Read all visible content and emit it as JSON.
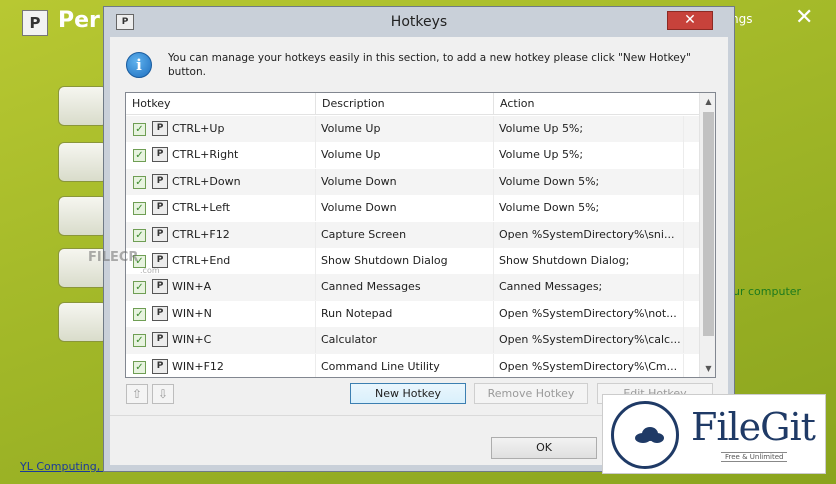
{
  "background": {
    "logo_letter": "P",
    "title_partial": "Per",
    "settings_partial": "ngs",
    "close_glyph": "✕",
    "message_partial": "ur computer",
    "footer_link_partial": "YL Computing, I"
  },
  "dialog": {
    "title": "Hotkeys",
    "title_icon_letter": "P",
    "close_glyph": "✕",
    "info_icon_glyph": "i",
    "info_text": "You can manage your hotkeys easily in this section, to add a new hotkey please click \"New Hotkey\" button.",
    "columns": [
      "Hotkey",
      "Description",
      "Action"
    ],
    "rows": [
      {
        "hotkey": "CTRL+Up",
        "description": "Volume Up",
        "action": "Volume Up 5%;"
      },
      {
        "hotkey": "CTRL+Right",
        "description": "Volume Up",
        "action": "Volume Up 5%;"
      },
      {
        "hotkey": "CTRL+Down",
        "description": "Volume Down",
        "action": "Volume Down 5%;"
      },
      {
        "hotkey": "CTRL+Left",
        "description": "Volume Down",
        "action": "Volume Down 5%;"
      },
      {
        "hotkey": "CTRL+F12",
        "description": "Capture Screen",
        "action": "Open %SystemDirectory%\\sni..."
      },
      {
        "hotkey": "CTRL+End",
        "description": "Show Shutdown Dialog",
        "action": "Show Shutdown Dialog;"
      },
      {
        "hotkey": "WIN+A",
        "description": "Canned Messages",
        "action": "Canned Messages;"
      },
      {
        "hotkey": "WIN+N",
        "description": "Run Notepad",
        "action": "Open %SystemDirectory%\\not..."
      },
      {
        "hotkey": "WIN+C",
        "description": "Calculator",
        "action": "Open %SystemDirectory%\\calc..."
      },
      {
        "hotkey": "WIN+F12",
        "description": "Command Line Utility",
        "action": "Open %SystemDirectory%\\Cm..."
      }
    ],
    "row_icon_letter": "P",
    "check_glyph": "✓",
    "scroll_up_glyph": "▲",
    "scroll_down_glyph": "▼",
    "move_up_glyph": "⇧",
    "move_down_glyph": "⇩",
    "buttons": {
      "new_hotkey": "New Hotkey",
      "remove_hotkey": "Remove Hotkey",
      "edit_hotkey": "Edit Hotkey",
      "ok": "OK"
    }
  },
  "watermark": {
    "filecr": "FILECR",
    "filecr_sub": ".com"
  },
  "badge": {
    "name": "FileGit",
    "tagline": "Free & Unlimited",
    "brand_color": "#1f3a66"
  }
}
